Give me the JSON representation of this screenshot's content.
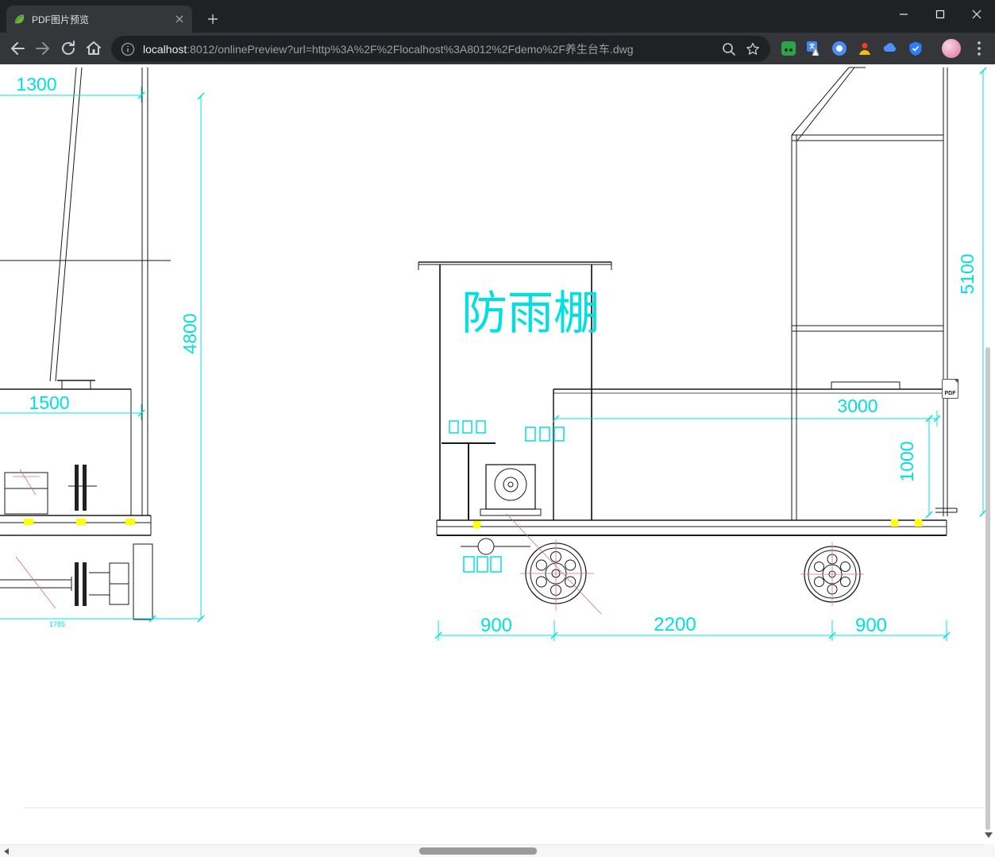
{
  "window": {
    "tab_title": "PDF图片预览"
  },
  "address": {
    "host": "localhost",
    "path": ":8012/onlinePreview?url=http%3A%2F%2Flocalhost%3A8012%2Fdemo%2F养生台车.dwg"
  },
  "pdf_badge": "PDF",
  "drawing": {
    "shelter": "防雨棚",
    "dim_1300": "1300",
    "dim_4800": "4800",
    "dim_1500": "1500",
    "dim_1785": "1785",
    "dim_5100": "5100",
    "dim_3000": "3000",
    "dim_1000": "1000",
    "dim_900_left": "900",
    "dim_2200": "2200",
    "dim_900_right": "900",
    "colors": {
      "dimension": "#00E0E0",
      "outline": "#1a1a1a",
      "centerline": "#D4707E",
      "hatch": "#FFFF00"
    }
  }
}
